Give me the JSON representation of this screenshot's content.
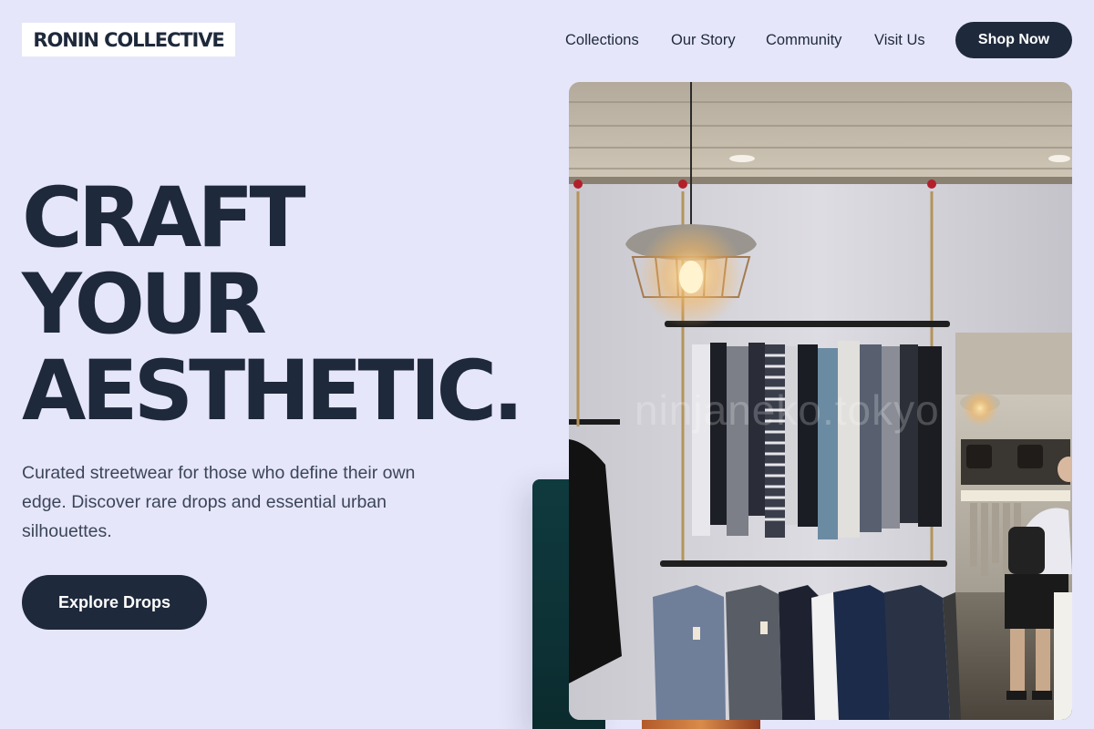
{
  "brand": {
    "name": "RONIN COLLECTIVE"
  },
  "nav": {
    "items": [
      {
        "label": "Collections"
      },
      {
        "label": "Our Story"
      },
      {
        "label": "Community"
      },
      {
        "label": "Visit Us"
      }
    ],
    "cta_label": "Shop Now"
  },
  "hero": {
    "headline_lines": [
      "CRAFT",
      "YOUR",
      "AESTHETIC."
    ],
    "description": "Curated streetwear for those who define their own edge. Discover rare drops and essential urban silhouettes.",
    "cta_label": "Explore Drops"
  },
  "image": {
    "watermark": "ninjaneko.tokyo"
  },
  "colors": {
    "background": "#e6e6fa",
    "primary": "#1e293b",
    "button_text": "#ffffff",
    "body_text": "#3b4559"
  }
}
